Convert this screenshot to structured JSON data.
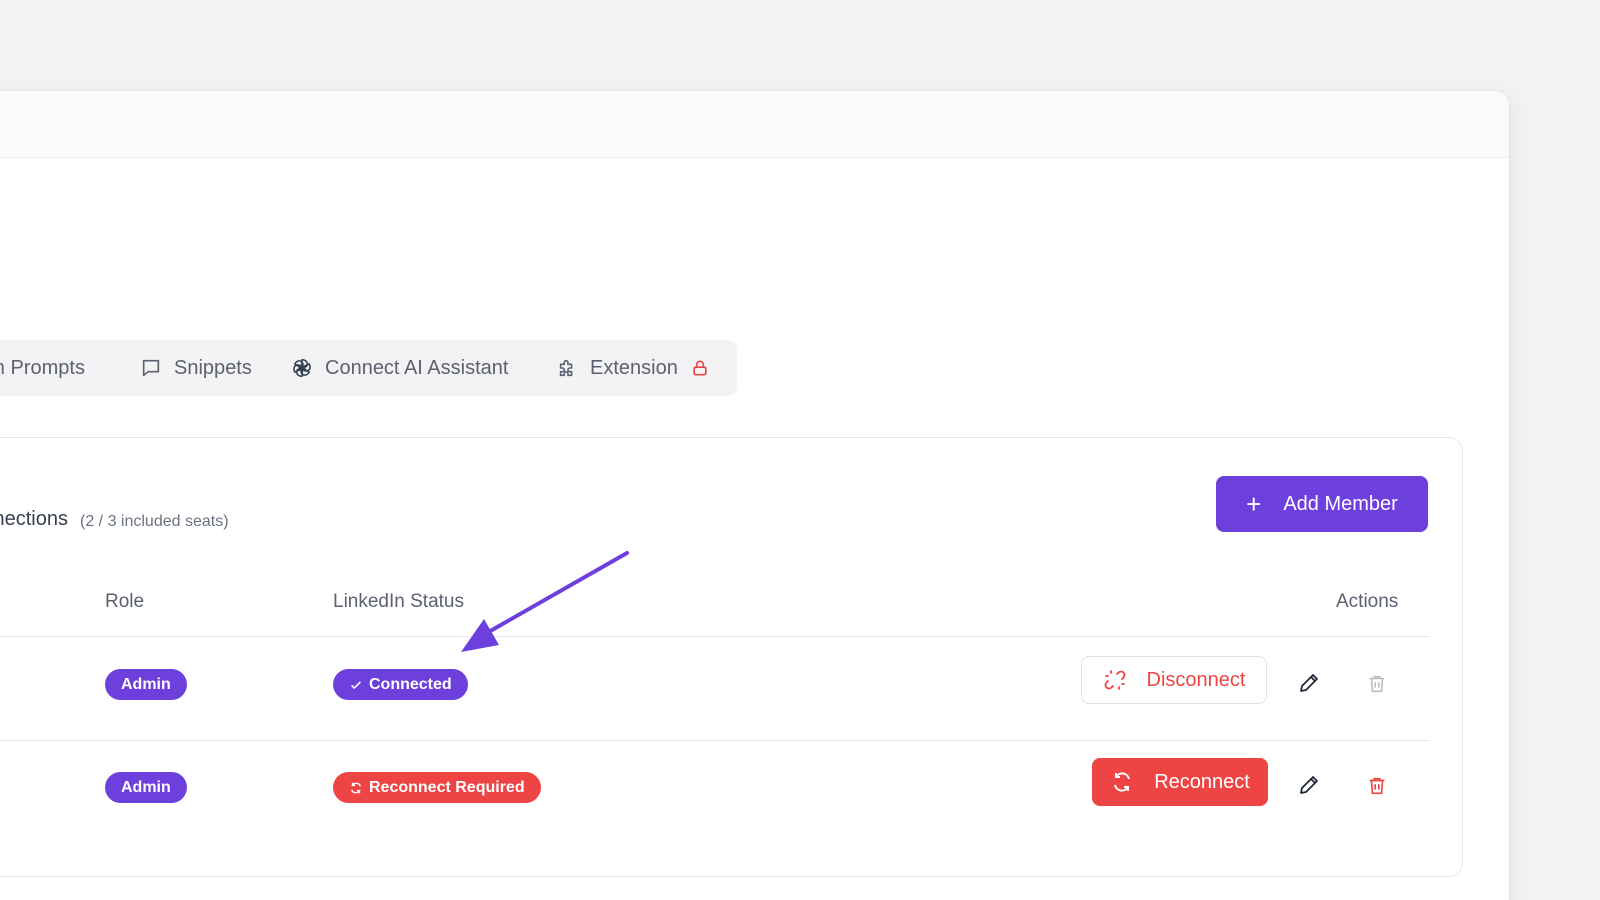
{
  "tabs": [
    {
      "label": "Custom Prompts",
      "icon": "custom-prompts-icon"
    },
    {
      "label": "Snippets",
      "icon": "chat-bubble-icon"
    },
    {
      "label": "Connect AI Assistant",
      "icon": "openai-icon"
    },
    {
      "label": "Extension",
      "icon": "puzzle-icon",
      "locked": true
    }
  ],
  "section": {
    "title": "Connections",
    "seats": "(2 / 3 included seats)",
    "add_button": "Add Member"
  },
  "table": {
    "headers": {
      "role": "Role",
      "status": "LinkedIn Status",
      "actions": "Actions"
    },
    "rows": [
      {
        "role": "Admin",
        "status": "Connected",
        "status_icon": "check-icon",
        "action": "Disconnect",
        "action_icon": "broken-link-icon"
      },
      {
        "role": "Admin",
        "status": "Reconnect Required",
        "status_icon": "refresh-icon",
        "action": "Reconnect",
        "action_icon": "refresh-icon"
      }
    ]
  },
  "colors": {
    "accent": "#6d3fdc",
    "danger": "#ef4444",
    "annotation_arrow": "#6d3fdc"
  }
}
